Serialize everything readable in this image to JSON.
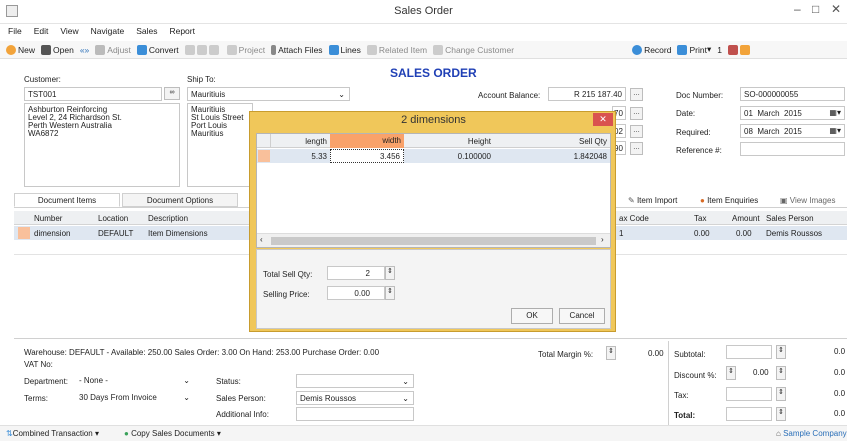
{
  "window": {
    "title": "Sales Order",
    "minimize": "–",
    "maximize": "□",
    "close": "✕"
  },
  "menu": [
    "File",
    "Edit",
    "View",
    "Navigate",
    "Sales",
    "Report"
  ],
  "toolbar": {
    "new": "New",
    "open": "Open",
    "adjust": "Adjust",
    "convert": "Convert",
    "project": "Project",
    "attach_files": "Attach Files",
    "lines": "Lines",
    "related_item": "Related Item",
    "change_customer": "Change Customer",
    "record": "Record",
    "print": "Print",
    "print_count": "1"
  },
  "header": {
    "heading": "SALES ORDER",
    "customer_label": "Customer:",
    "customer_code": "TST001",
    "customer_address": [
      "Ashburton Reinforcing",
      "Level 2, 24 Richardson St.",
      "Perth  Western Australia",
      "WA6872"
    ],
    "ship_to_label": "Ship To:",
    "ship_to": "Mauritiuis",
    "ship_address": [
      "Mauritiuis",
      "St Louis Street",
      "Port Louis",
      "Mauritius"
    ],
    "account_balance_label": "Account Balance:",
    "account_balance": "R 215 187.40",
    "partial_values": [
      "70",
      "02",
      "90"
    ],
    "doc_number_label": "Doc Number:",
    "doc_number": "SO-000000055",
    "date_label": "Date:",
    "date_day": "01",
    "date_month": "March",
    "date_year": "2015",
    "required_label": "Required:",
    "req_day": "08",
    "req_month": "March",
    "req_year": "2015",
    "reference_label": "Reference #:"
  },
  "tabs": {
    "items": "Document Items",
    "options": "Document Options"
  },
  "actions": {
    "item_import": "Item Import",
    "item_enquiries": "Item Enquiries",
    "view_images": "View Images"
  },
  "grid": {
    "headers": {
      "number": "Number",
      "location": "Location",
      "description": "Description",
      "tax_code": "ax Code",
      "tax": "Tax",
      "amount": "Amount",
      "sales_person": "Sales Person"
    },
    "row": {
      "number": "dimension",
      "location": "DEFAULT",
      "description": "Item Dimensions",
      "tax_code": "1",
      "tax": "0.00",
      "amount": "0.00",
      "sales_person": "Demis Roussos"
    }
  },
  "dialog": {
    "title": "2 dimensions",
    "close": "✕",
    "headers": {
      "length": "length",
      "width": "width",
      "height": "Height",
      "sell_qty": "Sell Qty"
    },
    "row": {
      "length": "5.33",
      "width": "3.456",
      "height": "0.100000",
      "sell_qty": "1.842048"
    },
    "total_sell_qty_label": "Total Sell Qty:",
    "total_sell_qty": "2",
    "selling_price_label": "Selling Price:",
    "selling_price": "0.00",
    "ok": "OK",
    "cancel": "Cancel"
  },
  "footer": {
    "warehouse_info": "Warehouse: DEFAULT - Available: 250.00  Sales Order: 3.00  On Hand: 253.00  Purchase Order: 0.00",
    "vat_label": "VAT No:",
    "department_label": "Department:",
    "department": "- None -",
    "terms_label": "Terms:",
    "terms": "30 Days From Invoice",
    "status_label": "Status:",
    "sales_person_label": "Sales Person:",
    "sales_person": "Demis Roussos",
    "additional_info_label": "Additional Info:",
    "total_margin_label": "Total Margin %:",
    "total_margin": "0.00",
    "subtotal_label": "Subtotal:",
    "subtotal": "0.0",
    "discount_label": "Discount %:",
    "discount_pct": "0.00",
    "discount": "0.0",
    "tax_label": "Tax:",
    "tax": "0.0",
    "total_label": "Total:",
    "total": "0.0"
  },
  "statusbar": {
    "combined": "Combined Transaction",
    "copy": "Copy Sales Documents",
    "company": "Sample Company"
  },
  "colors": {
    "dialog_accent": "#f0c75a",
    "heading": "#1f3fb5",
    "selected_header": "#f9a26a",
    "close_red": "#d9534f"
  }
}
